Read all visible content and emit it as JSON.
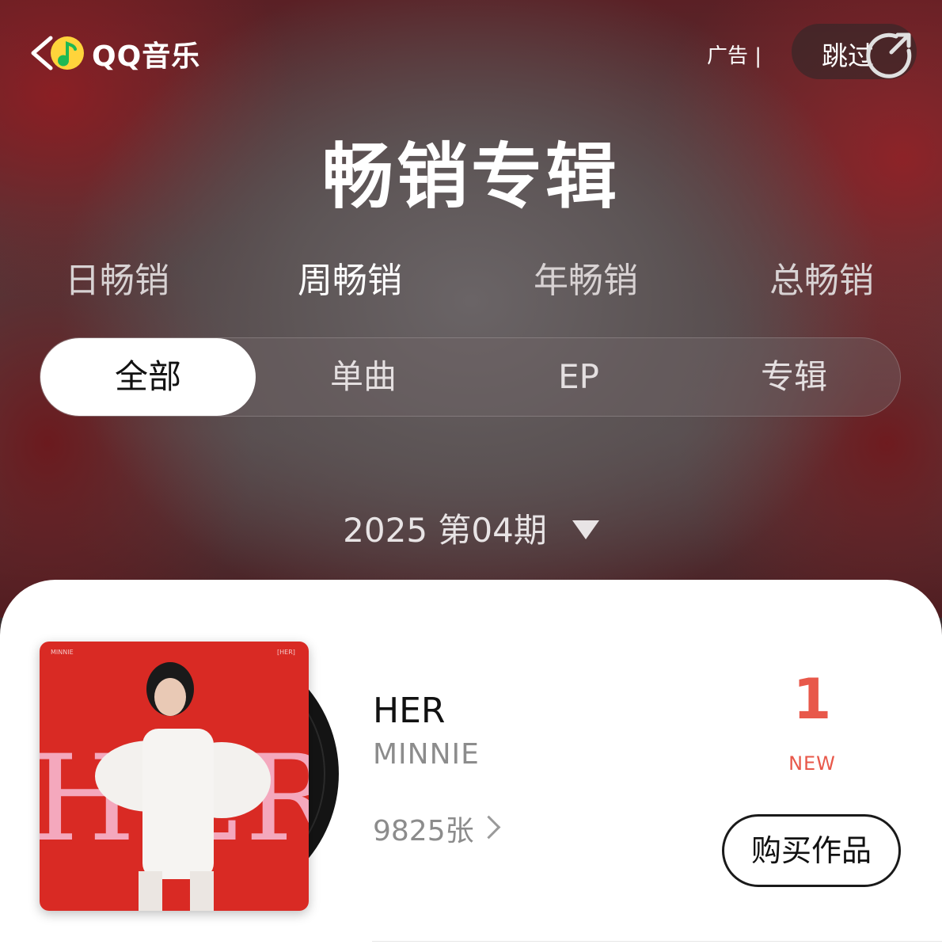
{
  "header": {
    "app_name": "QQ音乐",
    "ad_label": "广告 |",
    "skip_label": "跳过"
  },
  "page_title": "畅销专辑",
  "period_tabs": [
    {
      "label": "日畅销",
      "active": false
    },
    {
      "label": "周畅销",
      "active": true
    },
    {
      "label": "年畅销",
      "active": false
    },
    {
      "label": "总畅销",
      "active": false
    }
  ],
  "type_tabs": [
    {
      "label": "全部",
      "active": true
    },
    {
      "label": "单曲",
      "active": false
    },
    {
      "label": "EP",
      "active": false
    },
    {
      "label": "专辑",
      "active": false
    }
  ],
  "issue_selector": "2025 第04期",
  "album": {
    "cover_artist_text": "MINNIE",
    "cover_title_text": "[HER]",
    "title": "HER",
    "artist": "MINNIE",
    "sales": "9825张",
    "rank": "1",
    "rank_status": "NEW",
    "buy_label": "购买作品"
  },
  "colors": {
    "rank_accent": "#e8584a",
    "cover_red": "#d92a24",
    "cover_pink_letters": "#f4a8bd"
  }
}
